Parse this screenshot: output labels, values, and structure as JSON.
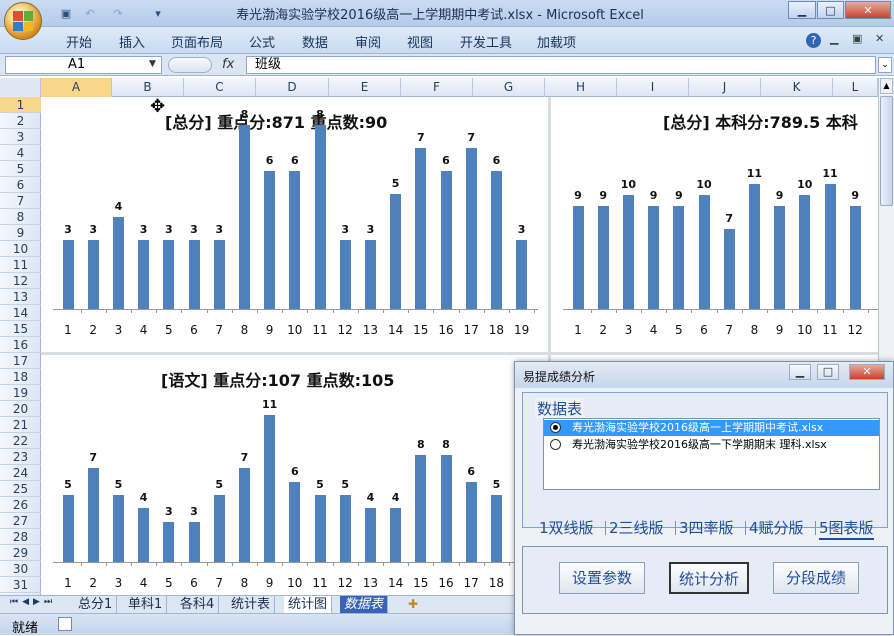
{
  "window": {
    "title": "寿光渤海实验学校2016级高一上学期期中考试.xlsx - Microsoft Excel"
  },
  "ribbon": {
    "tabs": [
      "开始",
      "插入",
      "页面布局",
      "公式",
      "数据",
      "审阅",
      "视图",
      "开发工具",
      "加载项"
    ]
  },
  "formula": {
    "cell_ref": "A1",
    "fx": "fx",
    "content": "班级"
  },
  "columns": [
    "A",
    "B",
    "C",
    "D",
    "E",
    "F",
    "G",
    "H",
    "I",
    "J",
    "K",
    "L"
  ],
  "rows": [
    "1",
    "2",
    "3",
    "4",
    "5",
    "6",
    "7",
    "8",
    "9",
    "10",
    "11",
    "12",
    "13",
    "14",
    "15",
    "16",
    "17",
    "18",
    "19",
    "20",
    "21",
    "22",
    "23",
    "24",
    "25",
    "26",
    "27",
    "28",
    "29",
    "30",
    "31"
  ],
  "chart_data": [
    {
      "type": "bar",
      "title": "[总分] 重点分:871  重点数:90",
      "categories": [
        "1",
        "2",
        "3",
        "4",
        "5",
        "6",
        "7",
        "8",
        "9",
        "10",
        "11",
        "12",
        "13",
        "14",
        "15",
        "16",
        "17",
        "18",
        "19"
      ],
      "values": [
        3,
        3,
        4,
        3,
        3,
        3,
        3,
        8,
        6,
        6,
        8,
        3,
        3,
        5,
        7,
        6,
        7,
        6,
        3
      ]
    },
    {
      "type": "bar",
      "title": "[总分] 本科分:789.5  本科",
      "categories": [
        "1",
        "2",
        "3",
        "4",
        "5",
        "6",
        "7",
        "8",
        "9",
        "10",
        "11",
        "12"
      ],
      "values": [
        9,
        9,
        10,
        9,
        9,
        10,
        7,
        11,
        9,
        10,
        11,
        9
      ]
    },
    {
      "type": "bar",
      "title": "[语文] 重点分:107  重点数:105",
      "categories": [
        "1",
        "2",
        "3",
        "4",
        "5",
        "6",
        "7",
        "8",
        "9",
        "10",
        "11",
        "12",
        "13",
        "14",
        "15",
        "16",
        "17",
        "18"
      ],
      "values": [
        5,
        7,
        5,
        4,
        3,
        3,
        5,
        7,
        11,
        6,
        5,
        5,
        4,
        4,
        8,
        8,
        6,
        5
      ]
    }
  ],
  "sheet_tabs": [
    "总分1",
    "单科1",
    "各科4",
    "统计表",
    "统计图",
    "数据表"
  ],
  "status": {
    "ready": "就绪"
  },
  "dialog": {
    "title": "易提成绩分析",
    "panel_label": "数据表",
    "files": [
      {
        "name": "寿光渤海实验学校2016级高一上学期期中考试.xlsx",
        "selected": true
      },
      {
        "name": "寿光渤海实验学校2016级高一下学期期末 理科.xlsx",
        "selected": false
      }
    ],
    "tabs": [
      "1双线版",
      "2三线版",
      "3四率版",
      "4赋分版",
      "5图表版"
    ],
    "buttons": [
      "设置参数",
      "统计分析",
      "分段成绩"
    ]
  },
  "colors": {
    "bar": "#4f81bd",
    "accent": "#1f4e9c",
    "selection": "#3399ff"
  }
}
